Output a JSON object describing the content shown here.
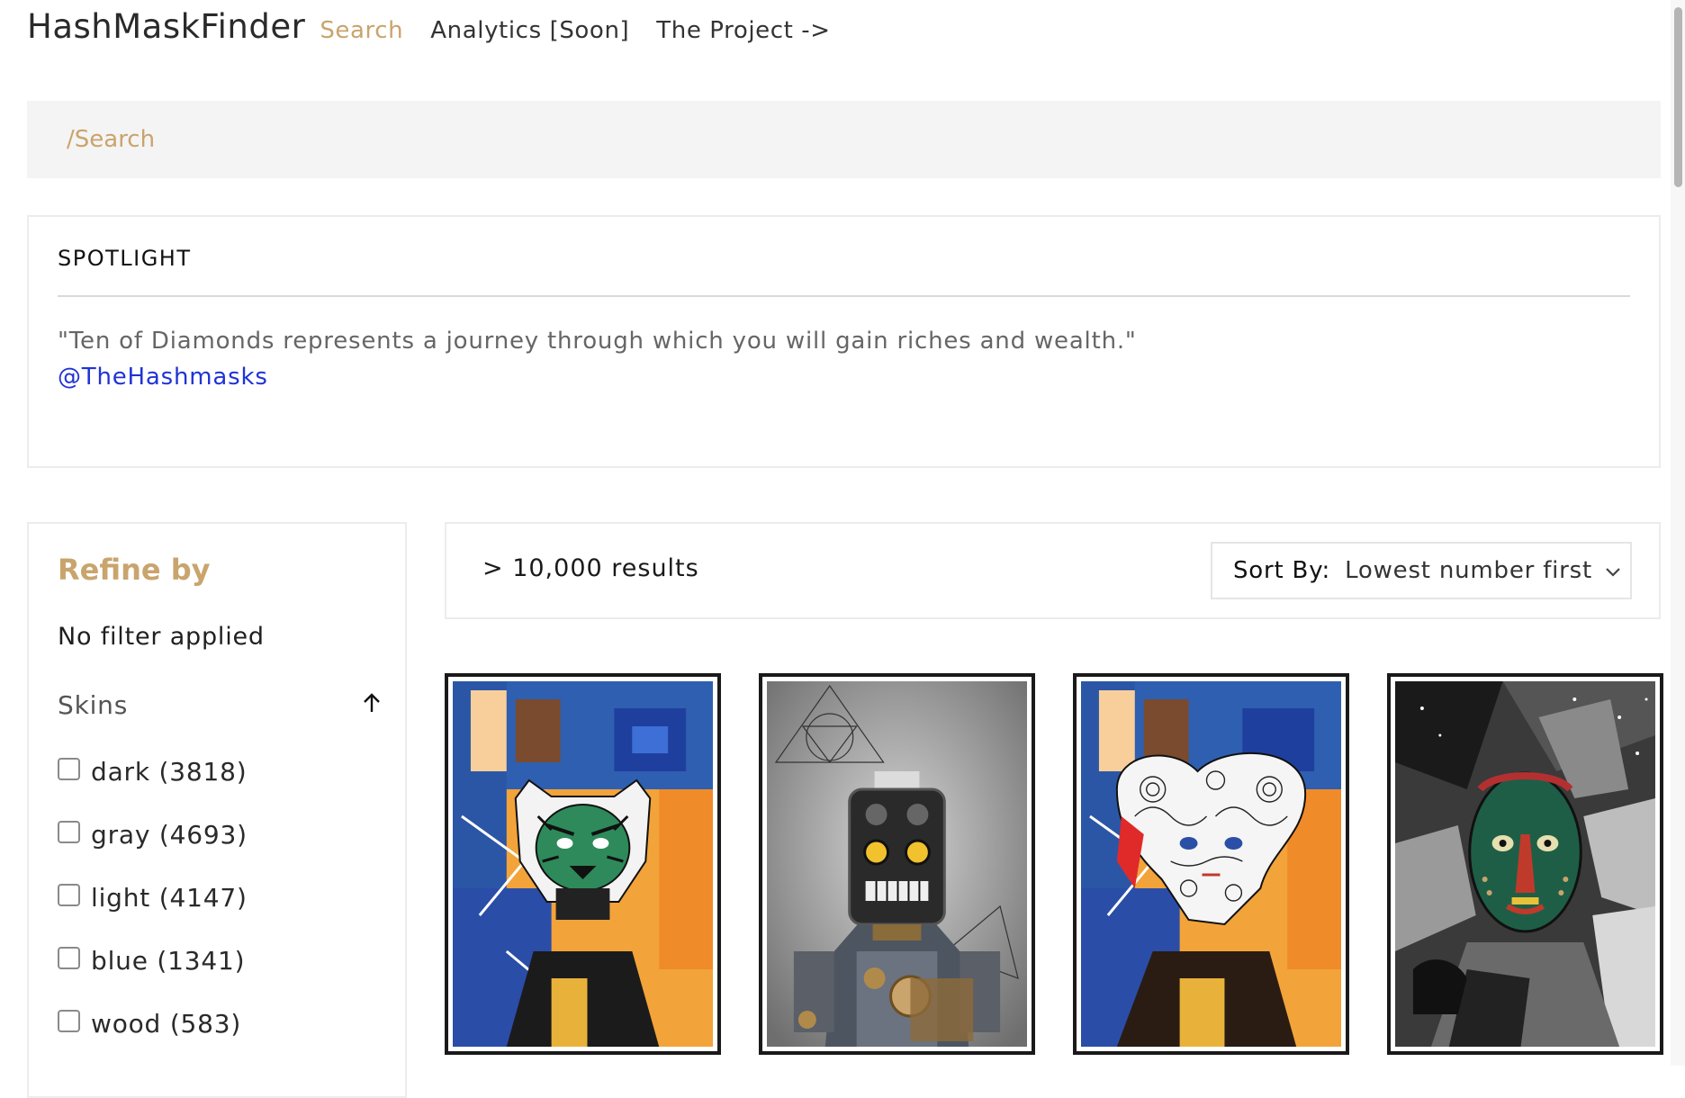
{
  "header": {
    "brand": "HashMaskFinder",
    "nav": [
      {
        "label": "Search",
        "active": true
      },
      {
        "label": "Analytics [Soon]",
        "active": false
      },
      {
        "label": "The Project ->",
        "active": false
      }
    ]
  },
  "search": {
    "placeholder": "/Search",
    "value": ""
  },
  "spotlight": {
    "title": "SPOTLIGHT",
    "quote": "\"Ten of Diamonds represents a journey through which you will gain riches and wealth.\"",
    "handle": "@TheHashmasks"
  },
  "sidebar": {
    "title": "Refine by",
    "filter_status": "No filter applied",
    "facet": {
      "title": "Skins",
      "toggle_icon": "arrow-up-icon",
      "options": [
        {
          "label": "dark (3818)",
          "checked": false
        },
        {
          "label": "gray (4693)",
          "checked": false
        },
        {
          "label": "light (4147)",
          "checked": false
        },
        {
          "label": "blue (1341)",
          "checked": false
        },
        {
          "label": "wood (583)",
          "checked": false
        }
      ]
    }
  },
  "results": {
    "count_label": "> 10,000 results",
    "sort_label": "Sort By:",
    "sort_value": "Lowest number first",
    "sort_icon": "chevron-down-icon"
  },
  "cards": [
    {
      "name": "tiger-mask-artwork"
    },
    {
      "name": "robot-mask-artwork"
    },
    {
      "name": "paisley-mask-artwork"
    },
    {
      "name": "tribal-mask-artwork"
    }
  ],
  "colors": {
    "accent": "#c9a46d",
    "link": "#2033d6",
    "panel_bg": "#f4f4f4",
    "border": "#ececec"
  }
}
